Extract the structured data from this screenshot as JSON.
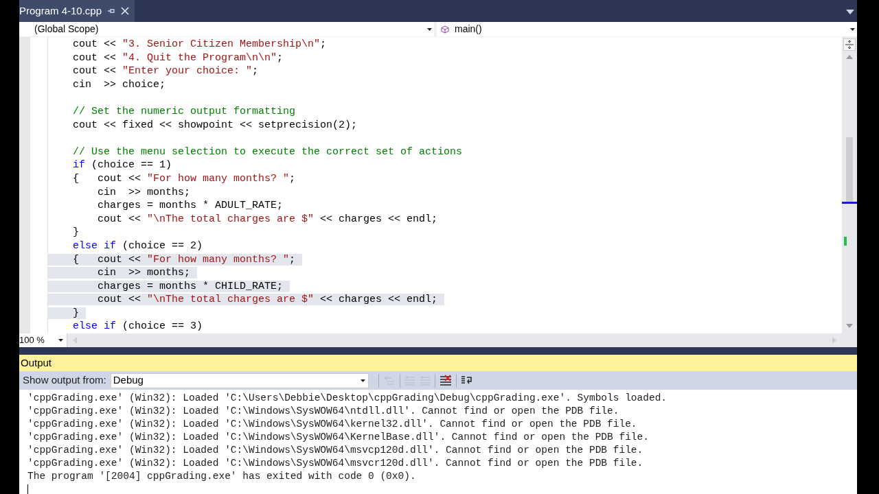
{
  "tab": {
    "title": "Program 4-10.cpp"
  },
  "navigation": {
    "scope": "(Global Scope)",
    "member": "main()"
  },
  "editor": {
    "zoom": "100 %",
    "lines": [
      {
        "kind": "code",
        "selected": false,
        "tokens": [
          {
            "kind": "plain",
            "text": "    cout << "
          },
          {
            "kind": "string",
            "text": "\"3. Senior Citizen Membership\\n\""
          },
          {
            "kind": "plain",
            "text": ";"
          }
        ]
      },
      {
        "kind": "code",
        "selected": false,
        "tokens": [
          {
            "kind": "plain",
            "text": "    cout << "
          },
          {
            "kind": "string",
            "text": "\"4. Quit the Program\\n\\n\""
          },
          {
            "kind": "plain",
            "text": ";"
          }
        ]
      },
      {
        "kind": "code",
        "selected": false,
        "tokens": [
          {
            "kind": "plain",
            "text": "    cout << "
          },
          {
            "kind": "string",
            "text": "\"Enter your choice: \""
          },
          {
            "kind": "plain",
            "text": ";"
          }
        ]
      },
      {
        "kind": "code",
        "selected": false,
        "tokens": [
          {
            "kind": "plain",
            "text": "    cin  >> choice;"
          }
        ]
      },
      {
        "kind": "blank"
      },
      {
        "kind": "code",
        "selected": false,
        "tokens": [
          {
            "kind": "comment",
            "text": "    // Set the numeric output formatting"
          }
        ]
      },
      {
        "kind": "code",
        "selected": false,
        "tokens": [
          {
            "kind": "plain",
            "text": "    cout << fixed << showpoint << setprecision(2);"
          }
        ]
      },
      {
        "kind": "blank"
      },
      {
        "kind": "code",
        "selected": false,
        "tokens": [
          {
            "kind": "comment",
            "text": "    // Use the menu selection to execute the correct set of actions"
          }
        ]
      },
      {
        "kind": "code",
        "selected": false,
        "tokens": [
          {
            "kind": "keyword",
            "text": "    if"
          },
          {
            "kind": "plain",
            "text": " (choice == 1)"
          }
        ]
      },
      {
        "kind": "code",
        "selected": false,
        "tokens": [
          {
            "kind": "plain",
            "text": "    {   cout << "
          },
          {
            "kind": "string",
            "text": "\"For how many months? \""
          },
          {
            "kind": "plain",
            "text": ";"
          }
        ]
      },
      {
        "kind": "code",
        "selected": false,
        "tokens": [
          {
            "kind": "plain",
            "text": "        cin  >> months;"
          }
        ]
      },
      {
        "kind": "code",
        "selected": false,
        "tokens": [
          {
            "kind": "plain",
            "text": "        charges = months * ADULT_RATE;"
          }
        ]
      },
      {
        "kind": "code",
        "selected": false,
        "tokens": [
          {
            "kind": "plain",
            "text": "        cout << "
          },
          {
            "kind": "string",
            "text": "\"\\nThe total charges are $\""
          },
          {
            "kind": "plain",
            "text": " << charges << endl;"
          }
        ]
      },
      {
        "kind": "code",
        "selected": false,
        "tokens": [
          {
            "kind": "plain",
            "text": "    }"
          }
        ]
      },
      {
        "kind": "code",
        "selected": false,
        "tokens": [
          {
            "kind": "keyword",
            "text": "    else if"
          },
          {
            "kind": "plain",
            "text": " (choice == 2)"
          }
        ]
      },
      {
        "kind": "code",
        "selected": true,
        "tokens": [
          {
            "kind": "plain",
            "text": "    {   cout << "
          },
          {
            "kind": "string",
            "text": "\"For how many months? \""
          },
          {
            "kind": "plain",
            "text": ";"
          }
        ]
      },
      {
        "kind": "code",
        "selected": true,
        "tokens": [
          {
            "kind": "plain",
            "text": "        cin  >> months;"
          }
        ]
      },
      {
        "kind": "code",
        "selected": true,
        "tokens": [
          {
            "kind": "plain",
            "text": "        charges = months * CHILD_RATE;"
          }
        ]
      },
      {
        "kind": "code",
        "selected": true,
        "tokens": [
          {
            "kind": "plain",
            "text": "        cout << "
          },
          {
            "kind": "string",
            "text": "\"\\nThe total charges are $\""
          },
          {
            "kind": "plain",
            "text": " << charges << endl;"
          }
        ]
      },
      {
        "kind": "code",
        "selected": true,
        "tokens": [
          {
            "kind": "plain",
            "text": "    }"
          }
        ]
      },
      {
        "kind": "code",
        "selected": false,
        "tokens": [
          {
            "kind": "keyword",
            "text": "    else if"
          },
          {
            "kind": "plain",
            "text": " (choice == 3)"
          }
        ]
      }
    ]
  },
  "output": {
    "title": "Output",
    "source_label": "Show output from:",
    "source": "Debug",
    "lines": [
      "'cppGrading.exe' (Win32): Loaded 'C:\\Users\\Debbie\\Desktop\\cppGrading\\Debug\\cppGrading.exe'. Symbols loaded.",
      "'cppGrading.exe' (Win32): Loaded 'C:\\Windows\\SysWOW64\\ntdll.dll'. Cannot find or open the PDB file.",
      "'cppGrading.exe' (Win32): Loaded 'C:\\Windows\\SysWOW64\\kernel32.dll'. Cannot find or open the PDB file.",
      "'cppGrading.exe' (Win32): Loaded 'C:\\Windows\\SysWOW64\\KernelBase.dll'. Cannot find or open the PDB file.",
      "'cppGrading.exe' (Win32): Loaded 'C:\\Windows\\SysWOW64\\msvcp120d.dll'. Cannot find or open the PDB file.",
      "'cppGrading.exe' (Win32): Loaded 'C:\\Windows\\SysWOW64\\msvcr120d.dll'. Cannot find or open the PDB file.",
      "The program '[2004] cppGrading.exe' has exited with code 0 (0x0)."
    ]
  }
}
